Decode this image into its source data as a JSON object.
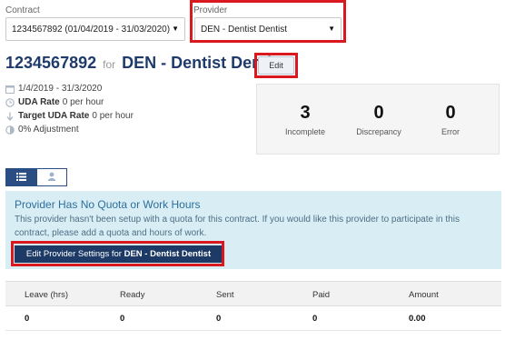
{
  "contract": {
    "label": "Contract",
    "selected": "1234567892 (01/04/2019 - 31/03/2020)"
  },
  "provider": {
    "label": "Provider",
    "selected": "DEN - Dentist Dentist"
  },
  "header": {
    "contract_number": "1234567892",
    "for_text": "for",
    "provider_name": "DEN - Dentist Dentist",
    "edit_label": "Edit"
  },
  "details": {
    "date_range": "1/4/2019 - 31/3/2020",
    "uda_rate_label": "UDA Rate",
    "uda_rate_value": "0 per hour",
    "target_uda_rate_label": "Target UDA Rate",
    "target_uda_rate_value": "0 per hour",
    "adjustment": "0% Adjustment"
  },
  "stats": [
    {
      "value": "3",
      "caption": "Incomplete"
    },
    {
      "value": "0",
      "caption": "Discrepancy"
    },
    {
      "value": "0",
      "caption": "Error"
    }
  ],
  "alert": {
    "heading": "Provider Has No Quota or Work Hours",
    "body": "This provider hasn't been setup with a quota for this contract. If you would like this provider to participate in this contract, please add a quota and hours of work.",
    "button_prefix": "Edit Provider Settings for",
    "button_provider": "DEN - Dentist Dentist"
  },
  "table": {
    "columns": [
      "Leave (hrs)",
      "Ready",
      "Sent",
      "Paid",
      "Amount"
    ],
    "row": [
      "0",
      "0",
      "0",
      "0",
      "0.00"
    ]
  },
  "colors": {
    "highlight": "#d9181f",
    "navy": "#1f3b6b",
    "alert_bg": "#d9edf4"
  },
  "icons": [
    "calendar-icon",
    "clock-icon",
    "arrow-down-icon",
    "adjustment-icon",
    "list-icon",
    "user-icon",
    "caret-down-icon"
  ]
}
